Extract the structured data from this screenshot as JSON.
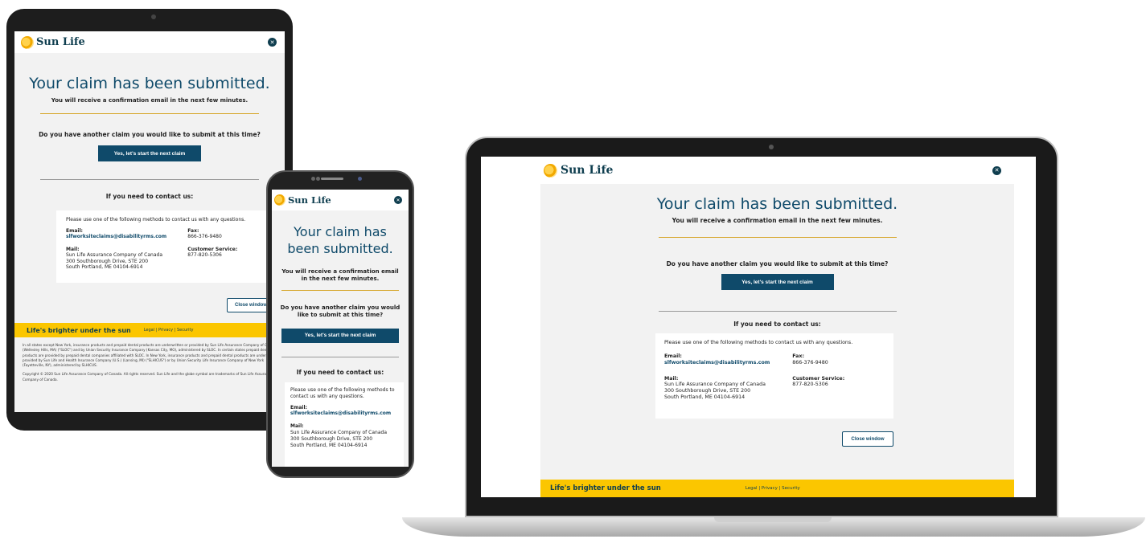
{
  "brand": {
    "name": "Sun Life",
    "colors": {
      "primary": "#0f4a6a",
      "gold": "#fbc600",
      "rule": "#d6a62a"
    }
  },
  "icons": {
    "close": "close-icon",
    "logo": "sun-globe-icon"
  },
  "claim": {
    "title": "Your claim has been submitted.",
    "subtitle": "You will receive a confirmation email in the next few minutes.",
    "question": "Do you have another claim you would like to submit at this time?",
    "next_button": "Yes, let's start the next claim",
    "contact_heading": "If you need to contact us:",
    "contact_intro": "Please use one of the following methods to contact us with any questions.",
    "email_label": "Email:",
    "email_value": "slfworksiteclaims@disabilityrms.com",
    "fax_label": "Fax:",
    "fax_value": "866-376-9480",
    "mail_label": "Mail:",
    "mail_line1": "Sun Life Assurance Company of Canada",
    "mail_line2": "300 Southborough Drive, STE 200",
    "mail_line3": "South Portland, ME  04104-6914",
    "service_label": "Customer Service:",
    "service_value": "877-820-5306",
    "close_button": "Close window"
  },
  "footer": {
    "tagline": "Life's brighter under the sun",
    "links": "Legal  |  Privacy  |  Security",
    "disclaimer": "In all states except New York, insurance products and prepaid dental products are underwritten or provided by Sun Life Assurance Company of Canada (Wellesley Hills, MA) (\"SLOC\") and by Union Security Insurance Company (Kansas City, MO), administered by SLOC. In certain states prepaid dental products are provided by prepaid dental companies affiliated with SLOC. In New York, insurance products and prepaid dental products are underwritten or provided by Sun Life and Health Insurance Company (U.S.) (Lansing, MI) (\"SLHICUS\") or by Union Security Life Insurance Company of New York (Fayetteville, NY), administered by SLHICUS.",
    "copyright": "Copyright © 2020 Sun Life Assurance Company of Canada. All rights reserved. Sun Life and the globe symbol are trademarks of Sun Life Assurance Company of Canada."
  }
}
